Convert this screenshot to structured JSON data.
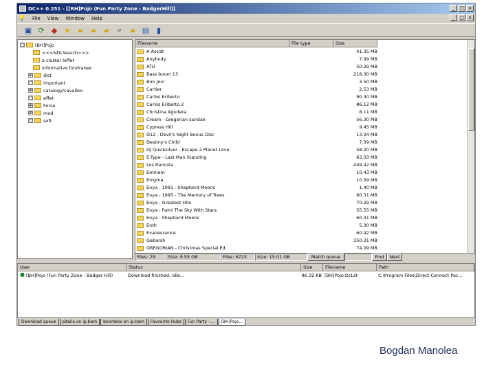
{
  "window": {
    "title": "DC++ 0.251 - [[RH]Pojo (Fun Party Zone - BadgerHill)]",
    "buttons": [
      "_",
      "□",
      "×"
    ]
  },
  "menu": [
    "File",
    "View",
    "Window",
    "Help"
  ],
  "toolbar_icons": [
    "floppy-icon",
    "refresh-icon",
    "gem-icon",
    "star-icon",
    "folder-hand-icon",
    "folder-recycle-icon",
    "folder-star-icon",
    "magnifier-icon",
    "folder-search-icon",
    "notes-icon",
    "book-icon"
  ],
  "tree": [
    {
      "label": "[BH]Pojo",
      "exp": "□"
    },
    {
      "label": "<<<NDLSearch>>>",
      "exp": ""
    },
    {
      "label": "a cluster leffet",
      "exp": ""
    },
    {
      "label": "informative fundraiser",
      "exp": ""
    },
    {
      "label": "dist",
      "exp": "⊞"
    },
    {
      "label": "important",
      "exp": "□"
    },
    {
      "label": "catalogy/cavalloo",
      "exp": "⊞"
    },
    {
      "label": "effet",
      "exp": "□"
    },
    {
      "label": "Forse",
      "exp": "⊞"
    },
    {
      "label": "mod",
      "exp": "⊞"
    },
    {
      "label": "soft",
      " exp": "□"
    }
  ],
  "files_header": {
    "filename": "Filename",
    "type": "File type",
    "size": "Size"
  },
  "files": [
    {
      "name": "A Assist",
      "size": "41.35 MB"
    },
    {
      "name": "Anybody",
      "size": "7.99 MB"
    },
    {
      "name": "ATU",
      "size": "50.29 MB"
    },
    {
      "name": "Bass boom 13",
      "size": "218.30 MB"
    },
    {
      "name": "Bon Jovi",
      "size": "3.50 MB"
    },
    {
      "name": "Cartier",
      "size": "2.53 MB"
    },
    {
      "name": "Carlos Eriberto",
      "size": "90.30 MB"
    },
    {
      "name": "Carlos Eriberto 2",
      "size": "86.12 MB"
    },
    {
      "name": "Christina Aguilera",
      "size": "8.11 MB"
    },
    {
      "name": "Cream - Gregorian sundae",
      "size": "56.30 MB"
    },
    {
      "name": "Cypress Hill",
      "size": "9.45 MB"
    },
    {
      "name": "D12 - Devil's Night Bonus Disc",
      "size": "13.34 MB"
    },
    {
      "name": "Destiny's Child",
      "size": "7.39 MB"
    },
    {
      "name": "DJ Quicksilver - Escape 2 Planet Love",
      "size": "58.20 MB"
    },
    {
      "name": "E-Type - Last Man Standing",
      "size": "63.03 MB"
    },
    {
      "name": "Los Rancola",
      "size": "449.42 MB"
    },
    {
      "name": "Eminem",
      "size": "10.43 MB"
    },
    {
      "name": "Enigma",
      "size": "10.59 MB"
    },
    {
      "name": "Enya - 1991 - Shepherd Moons",
      "size": "1.40 MB"
    },
    {
      "name": "Enya - 1995 - The Memory of Trees",
      "size": "60.31 MB"
    },
    {
      "name": "Enya - Greatest Hits",
      "size": "70.29 MB"
    },
    {
      "name": "Enya - Paint The Sky With Stars",
      "size": "55.55 MB"
    },
    {
      "name": "Enya - Shepherd Moons",
      "size": "60.31 MB"
    },
    {
      "name": "Enth",
      "size": "5.30 MB"
    },
    {
      "name": "Evanescence",
      "size": "60.42 MB"
    },
    {
      "name": "Gabarsh",
      "size": "350.31 MB"
    },
    {
      "name": "GREGORIAN - Christmas Special Ed",
      "size": "74.09 MB"
    }
  ],
  "status": {
    "items": "Files: 29",
    "total": "Size: 9.55 GB",
    "sel": "Files: 6723",
    "avail": "Size: 15.01 GB",
    "match_queue": "Match queue",
    "find": "Find",
    "next": "Next"
  },
  "queue_header": {
    "user": "User",
    "status": "Status",
    "size": "Size",
    "filename": "Filename",
    "path": "Path"
  },
  "queue_row": {
    "user": "[BH]Pojo (Fun Party Zone - Badger Hill)",
    "status": "Download finished, idle...",
    "size": "96.32 KB",
    "filename": "[BH]Pojo.DcLst",
    "path": "C:\\Program Files\\Direct Connect Pac..."
  },
  "tabs": [
    "Download queue",
    "pitalia on ip.bam",
    "boombox on ip.bam",
    "Favourite Hubs",
    "Fun Party - ...",
    "[BH]Pojo..."
  ],
  "author": "Bogdan Manolea"
}
